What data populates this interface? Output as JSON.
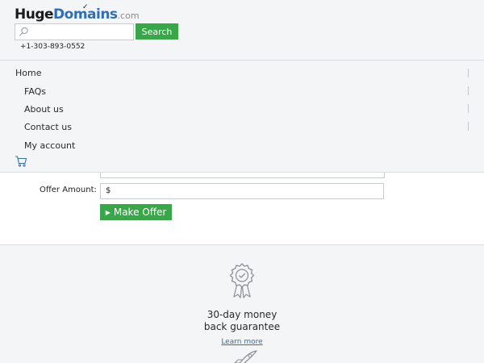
{
  "header": {
    "logo": {
      "part1": "Huge",
      "part2": "Domains",
      "tld": ".com"
    },
    "search": {
      "placeholder": "",
      "button_label": "Search"
    },
    "phone": "+1-303-893-0552"
  },
  "nav": {
    "items": [
      {
        "label": "Home"
      },
      {
        "label": "FAQs"
      },
      {
        "label": "About us"
      },
      {
        "label": "Contact us"
      },
      {
        "label": "My account"
      }
    ],
    "cart_icon": "cart-icon"
  },
  "offer_form": {
    "offer_label": "Offer Amount:",
    "currency_symbol": "$",
    "offer_value": "",
    "submit_label": "Make Offer"
  },
  "guarantee": {
    "icon": "award-ribbon-icon",
    "title_line1": "30-day money",
    "title_line2": "back guarantee",
    "link_label": "Learn more",
    "next_icon": "rocket-icon"
  },
  "colors": {
    "accent_green": "#3aa64a",
    "brand_blue": "#2f6fb2",
    "panel_bg": "#f3f5f7",
    "border": "#d9dde2"
  }
}
